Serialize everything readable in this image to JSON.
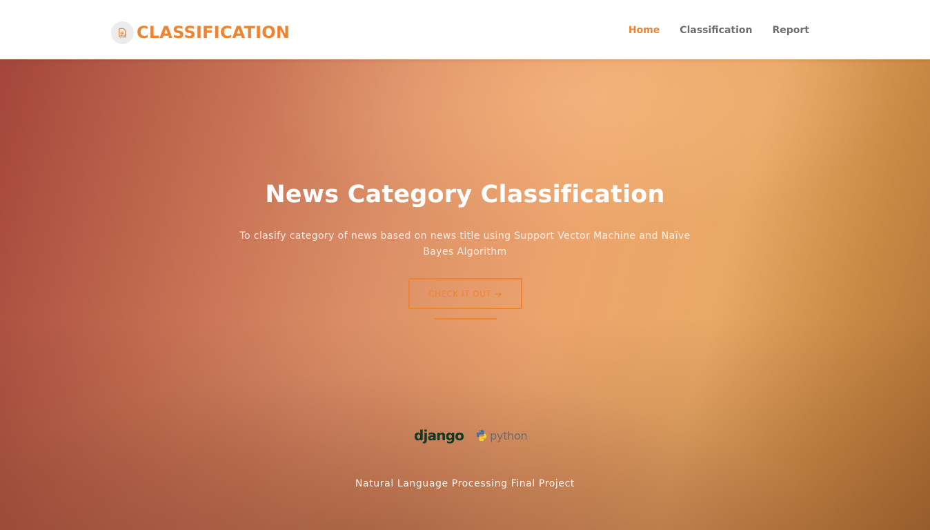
{
  "brand": {
    "name": "CLASSIFICATION",
    "icon": "document-icon",
    "color": "#ee8431"
  },
  "nav": {
    "items": [
      {
        "label": "Home",
        "active": true
      },
      {
        "label": "Classification",
        "active": false
      },
      {
        "label": "Report",
        "active": false
      }
    ]
  },
  "hero": {
    "title": "News Category Classification",
    "subtitle": "To clasify category of news based on news title using Support Vector Machine and Naïve Bayes Algorithm",
    "cta_label": "CHECK IT OUT",
    "cta_icon": "arrow-right-icon",
    "accent_color": "#ee8431"
  },
  "tech": {
    "django": "django",
    "python": "python"
  },
  "footer": {
    "text": "Natural Language Processing Final Project"
  }
}
